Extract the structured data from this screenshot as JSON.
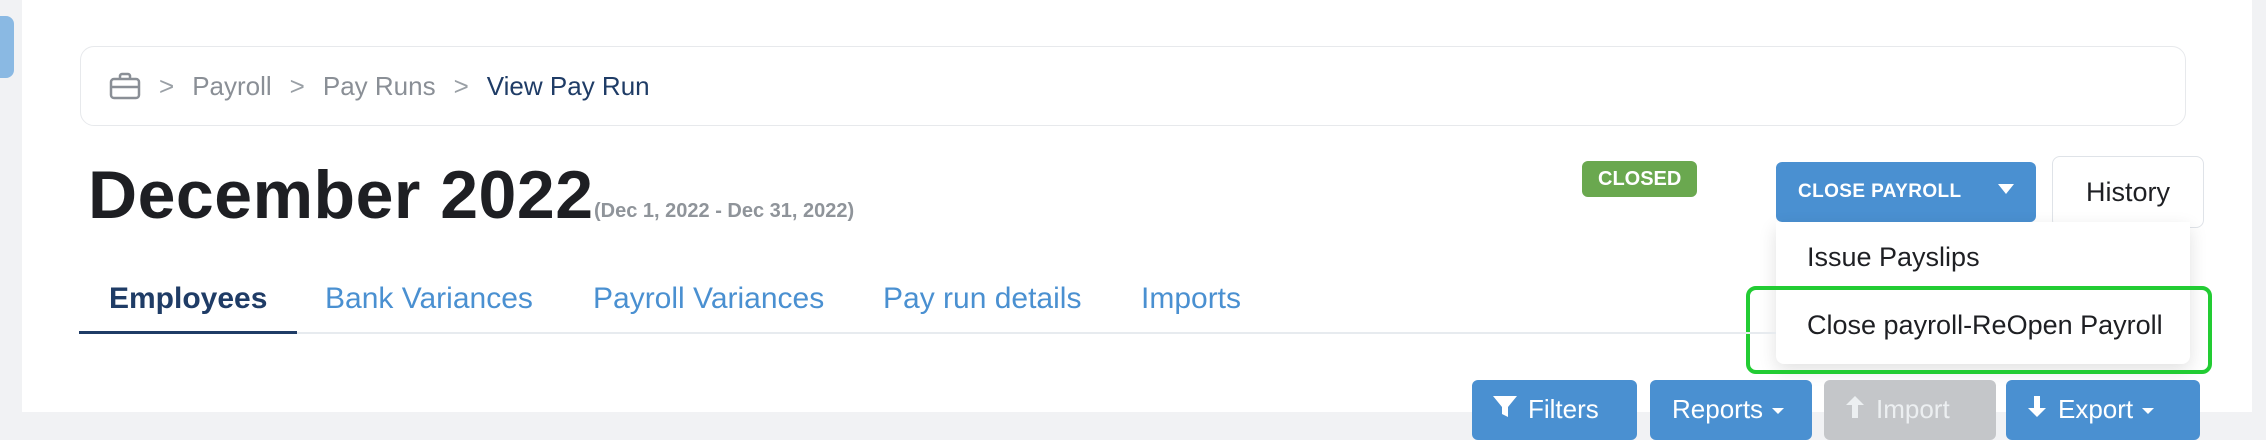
{
  "breadcrumb": {
    "icon": "briefcase-icon",
    "items": [
      "Payroll",
      "Pay Runs",
      "View Pay Run"
    ],
    "separator": ">"
  },
  "header": {
    "title": "December 2022",
    "subtitle": "(Dec 1, 2022 - Dec 31, 2022)",
    "status": "CLOSED"
  },
  "actions": {
    "close_payroll": "CLOSE PAYROLL",
    "history": "History"
  },
  "dropdown": {
    "items": [
      "Issue Payslips",
      "Close payroll-ReOpen Payroll"
    ]
  },
  "tabs": [
    "Employees",
    "Bank Variances",
    "Payroll Variances",
    "Pay run details",
    "Imports"
  ],
  "toolbar": {
    "filters": "Filters",
    "reports": "Reports",
    "import": "Import",
    "export": "Export"
  },
  "colors": {
    "primary": "#4a90d1",
    "navy": "#1f3c66",
    "status_green": "#6aa84f",
    "highlight_green": "#22cc33"
  }
}
